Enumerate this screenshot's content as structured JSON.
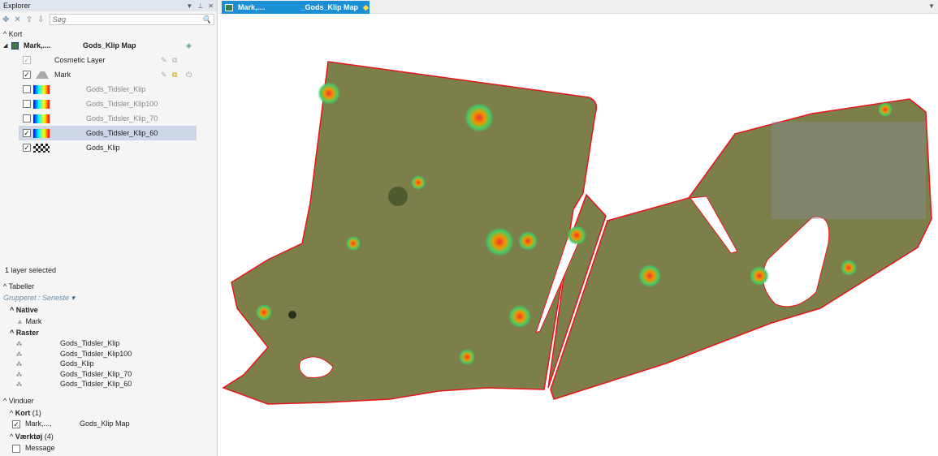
{
  "explorer": {
    "title": "Explorer",
    "search_placeholder": "Søg",
    "kort_label": "Kort",
    "map_item": {
      "name": "Mark,....",
      "title": "Gods_Klip Map"
    },
    "layers": [
      {
        "label": "Cosmetic Layer",
        "checked": true,
        "enabled": false
      },
      {
        "label": "Mark",
        "checked": true
      },
      {
        "label": "Gods_Tidsler_Klip",
        "checked": false
      },
      {
        "label": "Gods_Tidsler_Klip100",
        "checked": false
      },
      {
        "label": "Gods_Tidsler_Klip_70",
        "checked": false
      },
      {
        "label": "Gods_Tidsler_Klip_60",
        "checked": true,
        "selected": true
      },
      {
        "label": "Gods_Klip",
        "checked": true
      }
    ],
    "status": "1 layer selected",
    "tabeller": "Tabeller",
    "grouped": "Grupperet : Seneste",
    "native": "Native",
    "native_items": [
      "Mark"
    ],
    "raster": "Raster",
    "raster_items": [
      "Gods_Tidsler_Klip",
      "Gods_Tidsler_Klip100",
      "Gods_Klip",
      "Gods_Tidsler_Klip_70",
      "Gods_Tidsler_Klip_60"
    ],
    "vinduer": "Vinduer",
    "kort_win": "Kort",
    "kort_count": "(1)",
    "kort_win_item": {
      "name": "Mark,...,",
      "title": "Gods_Klip Map"
    },
    "vaerktoj": "Værktøj",
    "vaerktoj_count": "(4)",
    "message": "Message"
  },
  "tab": {
    "name": "Mark,....",
    "title": "_Gods_Klip Map"
  },
  "colors": {
    "accent": "#1b8fd6",
    "field": "#7c7f4a",
    "outline": "#e8141c"
  }
}
